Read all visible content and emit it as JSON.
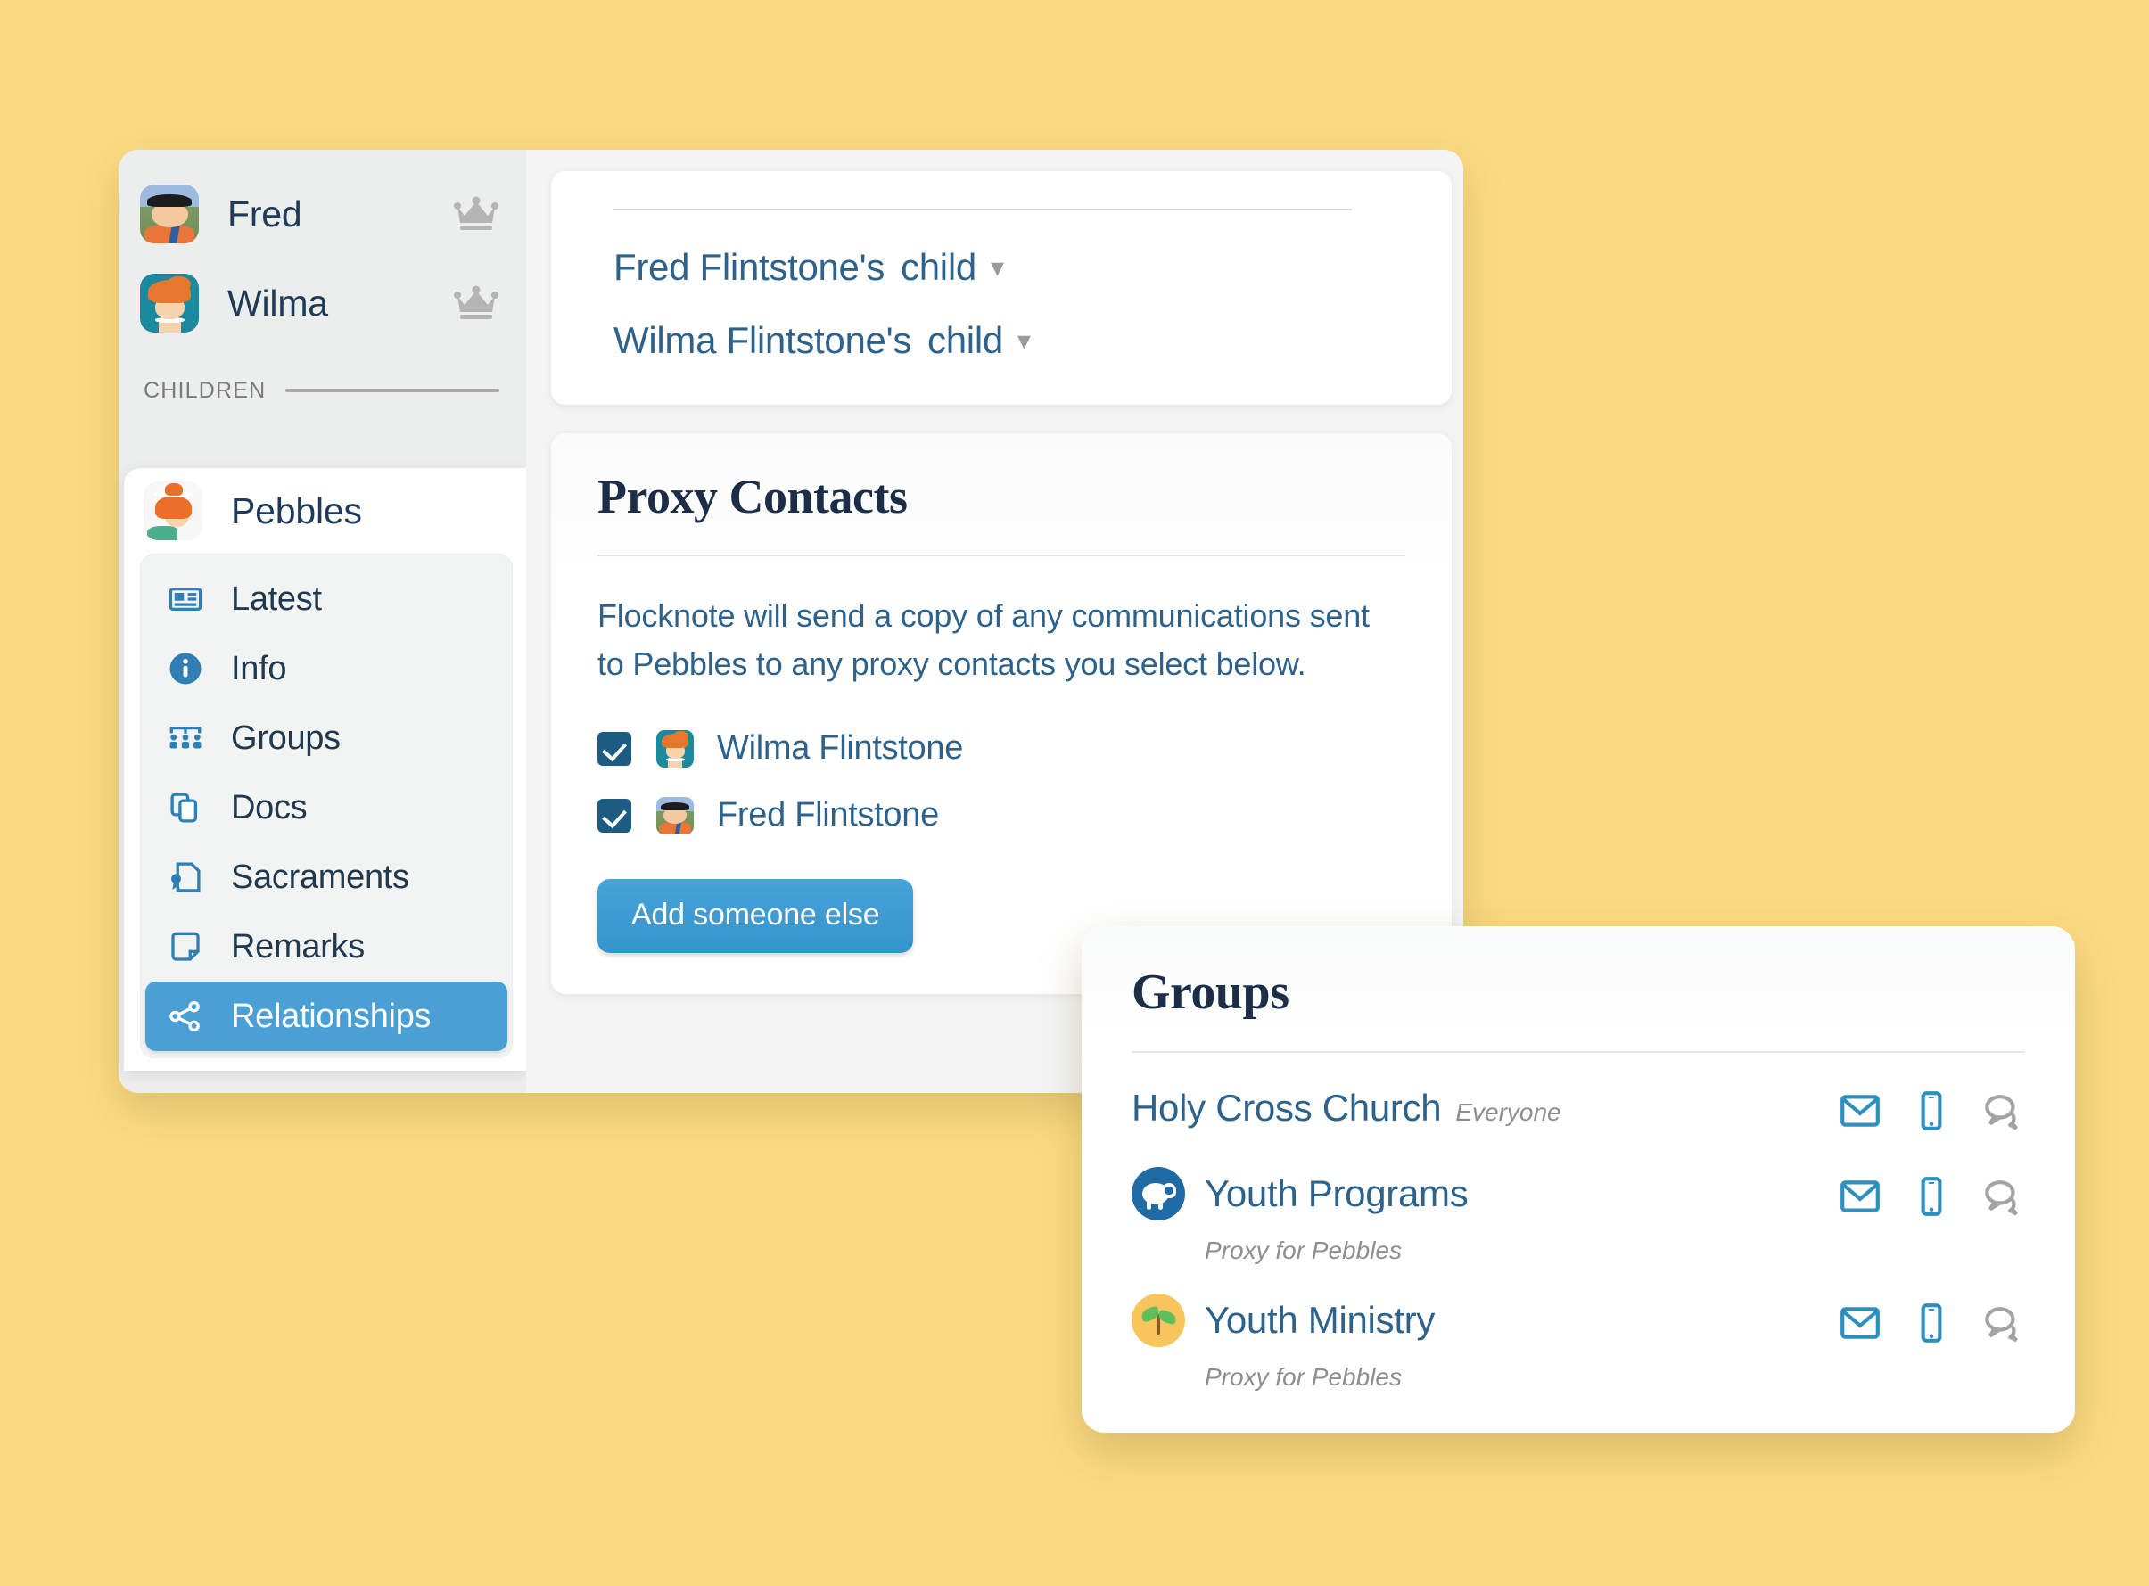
{
  "theme": {
    "background": "#fbda82",
    "accent_blue": "#4a9fd4",
    "link_blue": "#2d628c",
    "channel_blue": "#2f8ec0",
    "channel_gray": "#9a9a9a",
    "checkbox_blue": "#1d5c82",
    "heading_navy": "#1c2e47"
  },
  "sidebar": {
    "parents": [
      {
        "name": "Fred",
        "badge": "crown-icon",
        "avatar": "fred-avatar"
      },
      {
        "name": "Wilma",
        "badge": "crown-icon",
        "avatar": "wilma-avatar"
      }
    ],
    "section_label": "CHILDREN",
    "child": {
      "name": "Pebbles",
      "avatar": "pebbles-avatar"
    },
    "nav": [
      {
        "label": "Latest",
        "icon": "newspaper-icon",
        "active": false
      },
      {
        "label": "Info",
        "icon": "info-icon",
        "active": false
      },
      {
        "label": "Groups",
        "icon": "people-group-icon",
        "active": false
      },
      {
        "label": "Docs",
        "icon": "documents-icon",
        "active": false
      },
      {
        "label": "Sacraments",
        "icon": "certificate-icon",
        "active": false
      },
      {
        "label": "Remarks",
        "icon": "note-icon",
        "active": false
      },
      {
        "label": "Relationships",
        "icon": "share-nodes-icon",
        "active": true
      }
    ]
  },
  "relationships": {
    "rows": [
      {
        "owner": "Fred Flintstone's",
        "kind": "child",
        "chevron": "chevron-down-icon"
      },
      {
        "owner": "Wilma Flintstone's",
        "kind": "child",
        "chevron": "chevron-down-icon"
      }
    ]
  },
  "proxy_contacts": {
    "title": "Proxy Contacts",
    "description": "Flocknote will send a copy of any communications sent to Pebbles to any proxy contacts you select below.",
    "contacts": [
      {
        "name": "Wilma Flintstone",
        "checked": true,
        "avatar": "wilma-avatar"
      },
      {
        "name": "Fred Flintstone",
        "checked": true,
        "avatar": "fred-avatar"
      }
    ],
    "add_button_label": "Add someone else"
  },
  "groups_panel": {
    "title": "Groups",
    "groups": [
      {
        "name": "Holy Cross Church",
        "tag": "Everyone",
        "subtitle": "",
        "badge": "",
        "channels": [
          {
            "icon": "email-icon",
            "state": "on"
          },
          {
            "icon": "mobile-phone-icon",
            "state": "on"
          },
          {
            "icon": "chat-bubbles-icon",
            "state": "off"
          }
        ]
      },
      {
        "name": "Youth Programs",
        "tag": "",
        "subtitle": "Proxy for Pebbles",
        "badge": "sheep-icon",
        "channels": [
          {
            "icon": "email-icon",
            "state": "on"
          },
          {
            "icon": "mobile-phone-icon",
            "state": "on"
          },
          {
            "icon": "chat-bubbles-icon",
            "state": "off"
          }
        ]
      },
      {
        "name": "Youth Ministry",
        "tag": "",
        "subtitle": "Proxy for Pebbles",
        "badge": "sprout-icon",
        "channels": [
          {
            "icon": "email-icon",
            "state": "on"
          },
          {
            "icon": "mobile-phone-icon",
            "state": "on"
          },
          {
            "icon": "chat-bubbles-icon",
            "state": "off"
          }
        ]
      }
    ]
  }
}
